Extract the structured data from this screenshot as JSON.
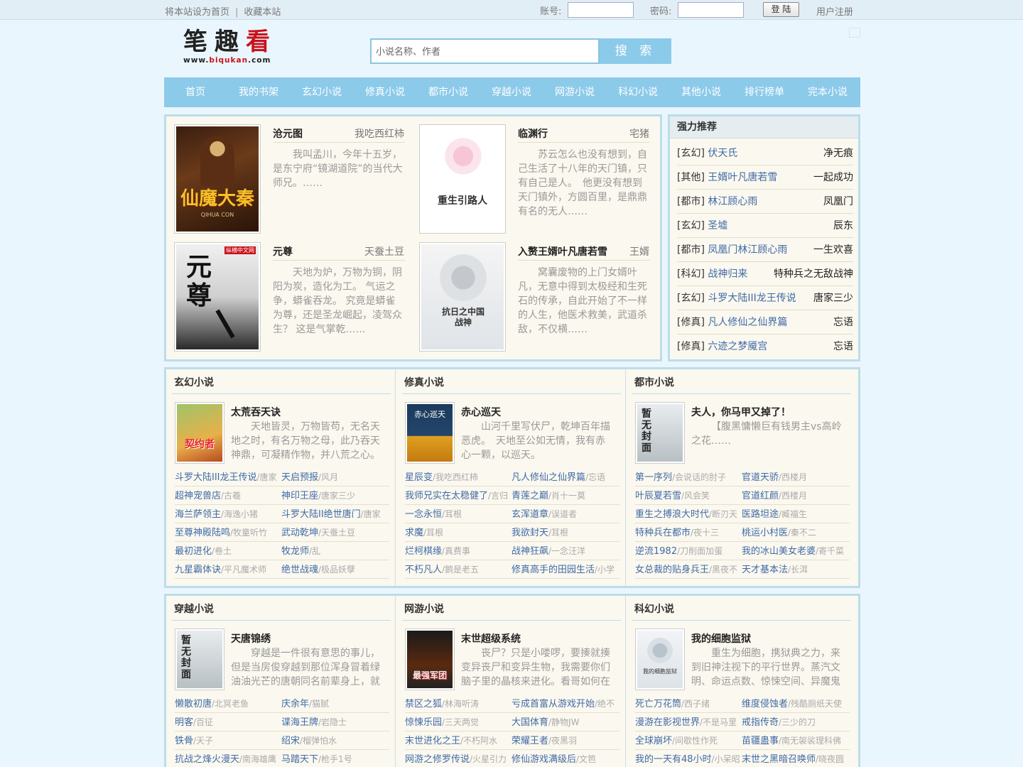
{
  "topbar": {
    "set_home": "将本站设为首页",
    "separator": "|",
    "bookmark": "收藏本站",
    "account_label": "账号:",
    "password_label": "密码:",
    "login_button": "登 陆",
    "register": "用户注册"
  },
  "logo": {
    "chars": [
      "笔",
      "趣",
      "看"
    ],
    "url_prefix": "www.",
    "url_mid": "biqukan",
    "url_suffix": ".com"
  },
  "search": {
    "placeholder": "小说名称、作者",
    "button": "搜 索"
  },
  "nav": [
    "首页",
    "我的书架",
    "玄幻小说",
    "修真小说",
    "都市小说",
    "穿越小说",
    "网游小说",
    "科幻小说",
    "其他小说",
    "排行榜单",
    "完本小说"
  ],
  "featured": [
    {
      "title": "沧元图",
      "author": "我吃西红柿",
      "desc": "我叫孟川，今年十五岁，是东宁府“镜湖道院”的当代大师兄。……",
      "cover_text": "仙魔大秦",
      "cover_sub": "QIHUA CON"
    },
    {
      "title": "临渊行",
      "author": "宅猪",
      "desc": "苏云怎么也没有想到，自己生活了十八年的天门镇，只有自己是人。　他更没有想到天门镇外，方圆百里，是鼎鼎有名的无人……",
      "cover_text": "重生引路人"
    },
    {
      "title": "元尊",
      "author": "天蚕土豆",
      "desc": "天地为炉，万物为铜，阴阳为炭，造化为工。 气运之争，蟒雀吞龙。 究竟是蟒雀为尊，还是圣龙崛起，凌驾众生？ 这是气掌乾……",
      "cover_text": "元尊",
      "cover_tag": "纵横中文网"
    },
    {
      "title": "入赘王婿叶凡唐若雪",
      "author": "王婿",
      "desc": "窝囊废物的上门女婿叶凡，无意中得到太极经和生死石的传承，自此开始了不一样的人生，他医术救美，武道杀敌，不仅横……",
      "cover_text": "抗日之中国战神"
    }
  ],
  "recommend": {
    "title": "强力推荐",
    "items": [
      {
        "cat": "[玄幻]",
        "name": "伏天氏",
        "author": "净无痕"
      },
      {
        "cat": "[其他]",
        "name": "王婿叶凡唐若雪",
        "author": "一起成功"
      },
      {
        "cat": "[都市]",
        "name": "林江顾心雨",
        "author": "凤凰门"
      },
      {
        "cat": "[玄幻]",
        "name": "圣墟",
        "author": "辰东"
      },
      {
        "cat": "[都市]",
        "name": "凤凰门林江顾心雨",
        "author": "一生欢喜"
      },
      {
        "cat": "[科幻]",
        "name": "战神归来",
        "author": "特种兵之无敌战神"
      },
      {
        "cat": "[玄幻]",
        "name": "斗罗大陆III龙王传说",
        "author": "唐家三少"
      },
      {
        "cat": "[修真]",
        "name": "凡人修仙之仙界篇",
        "author": "忘语"
      },
      {
        "cat": "[修真]",
        "name": "六迹之梦魇宫",
        "author": "忘语"
      }
    ]
  },
  "categories": [
    {
      "title": "玄幻小说",
      "book": "太荒吞天诀",
      "desc": "天地皆灵，万物皆苟，无名天地之时，有名万物之母，此乃吞天神鼎，可凝精作物，并八荒之心。 得",
      "cover_text": "契约者",
      "list": [
        [
          "斗罗大陆III龙王传说",
          "/唐家"
        ],
        [
          "天启预报",
          "/风月"
        ],
        [
          "超神宠兽店",
          "/古羲"
        ],
        [
          "神印王座",
          "/唐家三少"
        ],
        [
          "海兰萨领主",
          "/海逸小猪"
        ],
        [
          "斗罗大陆II绝世唐门",
          "/唐家"
        ],
        [
          "至尊神殿陆鸣",
          "/牧童听竹"
        ],
        [
          "武动乾坤",
          "/天蚕土豆"
        ],
        [
          "最初进化",
          "/卷土"
        ],
        [
          "牧龙师",
          "/乱"
        ],
        [
          "九星霸体诀",
          "/平凡魔术师"
        ],
        [
          "绝世战魂",
          "/极品妖孽"
        ]
      ]
    },
    {
      "title": "修真小说",
      "book": "赤心巡天",
      "desc": "山河千里写伏尸，乾坤百年描恶虎。　天地至公如无情，我有赤心一颗，以巡天。",
      "cover_text": "赤心巡天",
      "list": [
        [
          "星辰变",
          "/我吃西红柿"
        ],
        [
          "凡人修仙之仙界篇",
          "/忘语"
        ],
        [
          "我师兄实在太稳健了",
          "/言归"
        ],
        [
          "青莲之巅",
          "/肖十一莫"
        ],
        [
          "一念永恒",
          "/耳根"
        ],
        [
          "玄浑道章",
          "/误道者"
        ],
        [
          "求魔",
          "/耳根"
        ],
        [
          "我欲封天",
          "/耳根"
        ],
        [
          "烂柯棋缘",
          "/真费事"
        ],
        [
          "战神狂飙",
          "/一念汪洋"
        ],
        [
          "不朽凡人",
          "/鹅是老五"
        ],
        [
          "修真高手的田园生活",
          "/小学"
        ]
      ]
    },
    {
      "title": "都市小说",
      "book": "夫人，你马甲又掉了！",
      "desc": "【腹黑慵懒巨有钱男主vs高岭之花……",
      "cover_text": "暂无封面",
      "list": [
        [
          "第一序列",
          "/会说话的肘子"
        ],
        [
          "官道天骄",
          "/西楼月"
        ],
        [
          "叶辰夏若雪",
          "/风会笑"
        ],
        [
          "官道红颜",
          "/西楼月"
        ],
        [
          "重生之搏浪大时代",
          "/断刃天"
        ],
        [
          "医路坦途",
          "/臧福生"
        ],
        [
          "特种兵在都市",
          "/夜十三"
        ],
        [
          "桃运小村医",
          "/秦不二"
        ],
        [
          "逆流1982",
          "/刀削面加蛋"
        ],
        [
          "我的冰山美女老婆",
          "/寄千菜"
        ],
        [
          "女总裁的贴身兵王",
          "/黑夜不"
        ],
        [
          "天才基本法",
          "/长洱"
        ]
      ]
    },
    {
      "title": "穿越小说",
      "book": "天唐锦绣",
      "desc": "穿越是一件很有意思的事儿，但是当房俊穿越到那位浑身冒着绿油油光芒的唐朝同名前辈身上，就",
      "cover_text": "暂无封面",
      "list": [
        [
          "懒散初唐",
          "/北冥老鱼"
        ],
        [
          "庆余年",
          "/猫腻"
        ],
        [
          "明客",
          "/百征"
        ],
        [
          "谍海王牌",
          "/岩隐士"
        ],
        [
          "铁骨",
          "/天子"
        ],
        [
          "绍宋",
          "/榴弹怕水"
        ],
        [
          "抗战之烽火漫天",
          "/南海雄鹰"
        ],
        [
          "马踏天下",
          "/枪手1号"
        ]
      ]
    },
    {
      "title": "网游小说",
      "book": "末世超级系统",
      "desc": "丧尸？只是小喽啰，要揍就揍变异丧尸和变异生物，我需要你们脑子里的晶核来进化。看哥如何在这末",
      "cover_text": "最强军团",
      "list": [
        [
          "禁区之狐",
          "/林海听涛"
        ],
        [
          "亏成首富从游戏开始",
          "/绝不"
        ],
        [
          "惊悚乐园",
          "/三天两觉"
        ],
        [
          "大国体育",
          "/静物JW"
        ],
        [
          "末世进化之王",
          "/不朽阿水"
        ],
        [
          "荣耀王者",
          "/夜黑羽"
        ],
        [
          "网游之修罗传说",
          "/火星引力"
        ],
        [
          "修仙游戏满级后",
          "/文笆"
        ]
      ]
    },
    {
      "title": "科幻小说",
      "book": "我的细胞监狱",
      "desc": "重生为细胞，携狱典之力，来到旧神注视下的平行世界。蒸汽文明、命运点数、惊悚空间、异魔鬼",
      "cover_text": "我的细胞监狱",
      "list": [
        [
          "死亡万花筒",
          "/西子绪"
        ],
        [
          "维度侵蚀者",
          "/残酷厕纸天使"
        ],
        [
          "漫游在影视世界",
          "/不是马里"
        ],
        [
          "戒指传奇",
          "/三少的刀"
        ],
        [
          "全球崩坏",
          "/间歇性作死"
        ],
        [
          "苗疆蛊事",
          "/南无袈裟理科佛"
        ],
        [
          "我的一天有48小时",
          "/小呆昭"
        ],
        [
          "末世之黑暗召唤师",
          "/晓夜圆"
        ]
      ]
    }
  ]
}
